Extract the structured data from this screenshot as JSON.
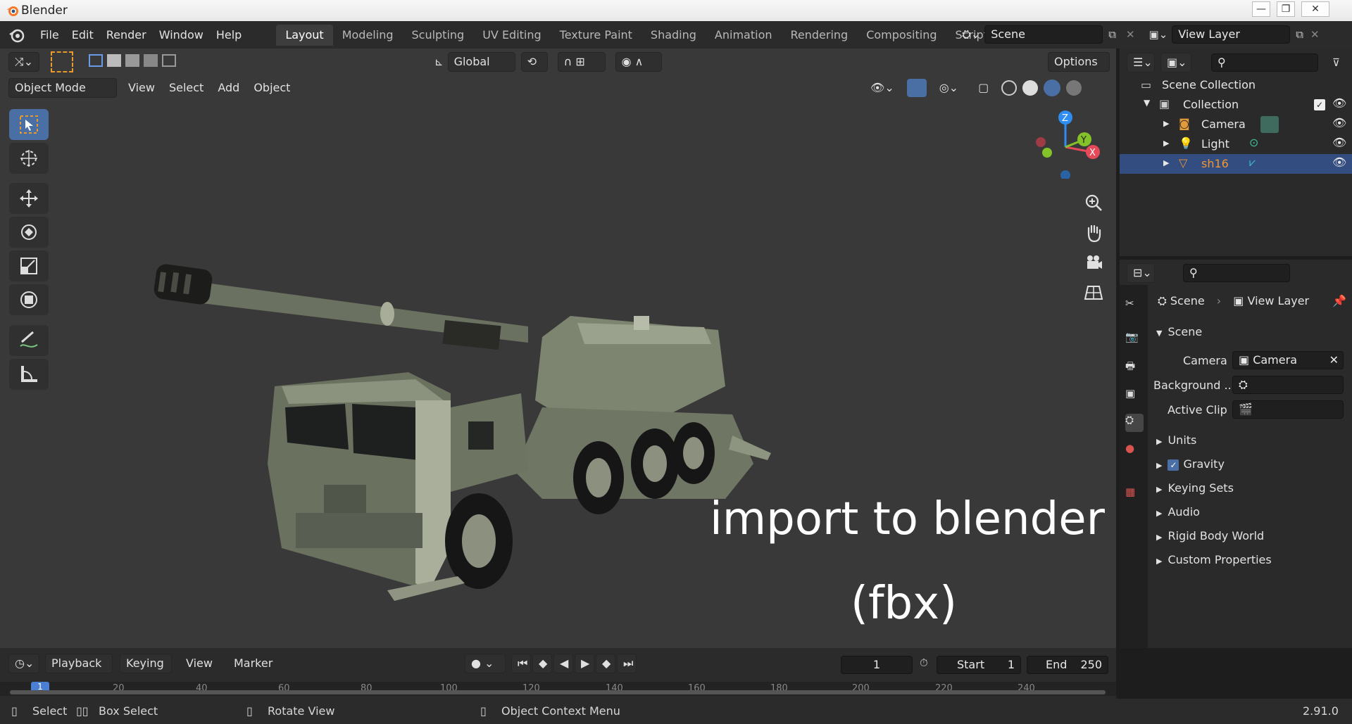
{
  "window": {
    "title": "Blender",
    "controls": [
      "minimize-icon",
      "maximize-icon",
      "close-icon"
    ]
  },
  "menu": {
    "items": [
      "File",
      "Edit",
      "Render",
      "Window",
      "Help"
    ]
  },
  "workspaces": {
    "tabs": [
      "Layout",
      "Modeling",
      "Sculpting",
      "UV Editing",
      "Texture Paint",
      "Shading",
      "Animation",
      "Rendering",
      "Compositing",
      "Scripting"
    ],
    "active": "Layout",
    "add_label": "+"
  },
  "scene_selector": {
    "value": "Scene"
  },
  "view_layer_selector": {
    "value": "View Layer"
  },
  "viewport": {
    "transform_orientation": "Global",
    "options_label": "Options",
    "mode": "Object Mode",
    "header_menus": [
      "View",
      "Select",
      "Add",
      "Object"
    ],
    "overlay_text_line1": "import to blender",
    "overlay_text_line2": "(fbx)",
    "gizmo": {
      "x": "X",
      "y": "Y",
      "z": "Z",
      "colors": {
        "x": "#e64a59",
        "y": "#84c22a",
        "z": "#2f8df1"
      }
    }
  },
  "outliner": {
    "root": "Scene Collection",
    "collection": "Collection",
    "items": [
      {
        "name": "Camera",
        "icon": "camera-icon",
        "color": "#e0e0e0"
      },
      {
        "name": "Light",
        "icon": "light-icon",
        "color": "#e0e0e0"
      },
      {
        "name": "sh16",
        "icon": "mesh-icon",
        "color": "#f4962d"
      }
    ]
  },
  "properties": {
    "breadcrumb": {
      "scene": "Scene",
      "view_layer": "View Layer"
    },
    "panel_title": "Scene",
    "camera_label": "Camera",
    "camera_value": "Camera",
    "background_label": "Background ...",
    "active_clip_label": "Active Clip",
    "sections": [
      "Units",
      "Gravity",
      "Keying Sets",
      "Audio",
      "Rigid Body World",
      "Custom Properties"
    ],
    "gravity_checked": true
  },
  "timeline": {
    "menus": [
      "Playback",
      "Keying",
      "View",
      "Marker"
    ],
    "current_frame": "1",
    "start_label": "Start",
    "start_value": "1",
    "end_label": "End",
    "end_value": "250",
    "ruler": [
      "1",
      "20",
      "40",
      "60",
      "80",
      "100",
      "120",
      "140",
      "160",
      "180",
      "200",
      "220",
      "240"
    ]
  },
  "statusbar": {
    "select": "Select",
    "box_select": "Box Select",
    "rotate_view": "Rotate View",
    "context_menu": "Object Context Menu",
    "version": "2.91.0"
  },
  "colors": {
    "accent": "#4a6fa5",
    "selection_row": "#334d80",
    "object_highlight": "#f4962d"
  }
}
